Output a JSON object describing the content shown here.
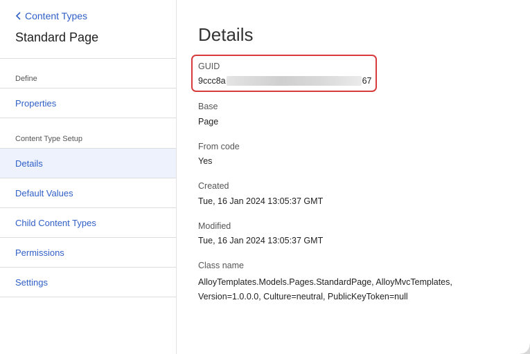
{
  "sidebar": {
    "back_label": "Content Types",
    "title": "Standard Page",
    "section_define": "Define",
    "section_setup": "Content Type Setup",
    "items": [
      {
        "label": "Properties"
      },
      {
        "label": "Details"
      },
      {
        "label": "Default Values"
      },
      {
        "label": "Child Content Types"
      },
      {
        "label": "Permissions"
      },
      {
        "label": "Settings"
      }
    ],
    "active_item": "Details"
  },
  "details": {
    "title": "Details",
    "guid_label": "GUID",
    "guid_prefix": "9ccc8a",
    "guid_suffix": "67",
    "base_label": "Base",
    "base_value": "Page",
    "fromcode_label": "From code",
    "fromcode_value": "Yes",
    "created_label": "Created",
    "created_value": "Tue, 16 Jan 2024 13:05:37 GMT",
    "modified_label": "Modified",
    "modified_value": "Tue, 16 Jan 2024 13:05:37 GMT",
    "classname_label": "Class name",
    "classname_value": "AlloyTemplates.Models.Pages.StandardPage, AlloyMvcTemplates, Version=1.0.0.0, Culture=neutral, PublicKeyToken=null"
  },
  "colors": {
    "link": "#2f5fc6",
    "active_bg": "#eef2fd",
    "highlight": "#d63a3a"
  },
  "icons": {
    "back": "chevron-left-icon"
  }
}
